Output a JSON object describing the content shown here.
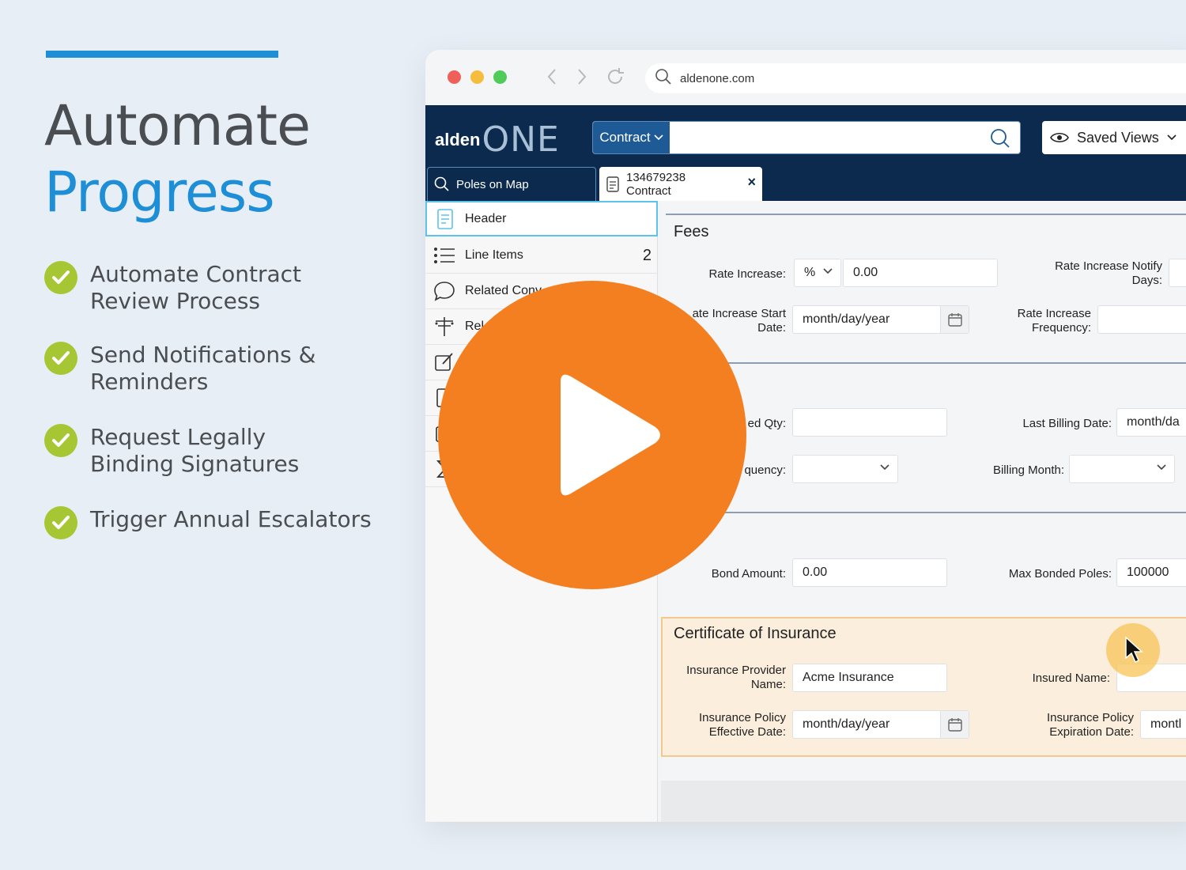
{
  "headline": {
    "line1": "Automate",
    "line2": "Progress"
  },
  "features": [
    {
      "line1": "Automate Contract",
      "line2": "Review Process"
    },
    {
      "line1": "Send Notifications &",
      "line2": "Reminders"
    },
    {
      "line1": "Request Legally",
      "line2": "Binding Signatures"
    },
    {
      "line1": "Trigger Annual Escalators",
      "line2": ""
    }
  ],
  "browser": {
    "url": "aldenone.com"
  },
  "app": {
    "logo_prefix": "alden",
    "logo_suffix": "ONE",
    "search_type": "Contract",
    "saved_views": "Saved Views",
    "tabs": [
      {
        "label": "Poles on Map"
      },
      {
        "line1": "134679238",
        "line2": "Contract"
      }
    ]
  },
  "sidebar": {
    "items": [
      {
        "label": "Header",
        "count": ""
      },
      {
        "label": "Line Items",
        "count": "2"
      },
      {
        "label": "Related Conv",
        "count": ""
      },
      {
        "label": "Rel",
        "count": ""
      }
    ]
  },
  "form": {
    "fees_title": "Fees",
    "rate_increase_label": "Rate Increase:",
    "rate_increase_unit": "%",
    "rate_increase_value": "0.00",
    "rate_increase_notify_label1": "Rate Increase Notify",
    "rate_increase_notify_label2": "Days:",
    "rate_increase_start_label1": "ate Increase Start",
    "rate_increase_start_label2": "Date:",
    "date_placeholder": "month/day/year",
    "rate_increase_freq_label1": "Rate Increase",
    "rate_increase_freq_label2": "Frequency:",
    "qty_label": "ed Qty:",
    "last_billing_label": "Last Billing Date:",
    "last_billing_value": "month/da",
    "frequency_label": "quency:",
    "billing_month_label": "Billing Month:",
    "bond_amount_label": "Bond Amount:",
    "bond_amount_value": "0.00",
    "max_bonded_label": "Max Bonded Poles:",
    "max_bonded_value": "100000",
    "insurance_title": "Certificate of Insurance",
    "provider_label1": "Insurance Provider",
    "provider_label2": "Name:",
    "provider_value": "Acme Insurance",
    "insured_name_label": "Insured Name:",
    "effective_label1": "Insurance Policy",
    "effective_label2": "Effective Date:",
    "expiration_label1": "Insurance Policy",
    "expiration_label2": "Expiration Date:",
    "expiration_value": "montl"
  },
  "colors": {
    "accent": "#1e8fd6",
    "check": "#a7c633",
    "play": "#f47f20",
    "navy": "#0b2a4d"
  }
}
